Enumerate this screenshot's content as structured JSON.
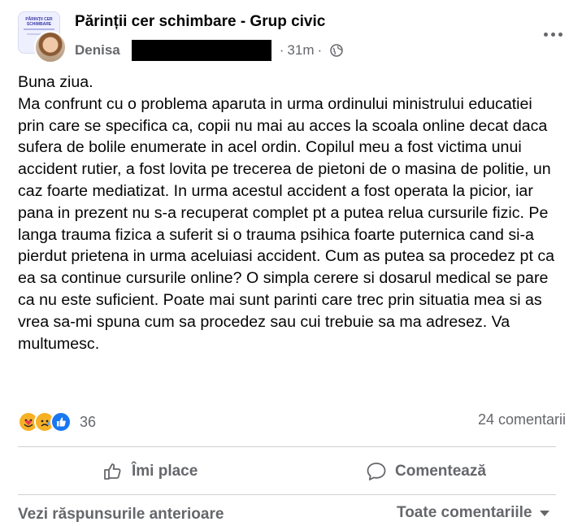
{
  "header": {
    "group_name": "Părinții cer schimbare - Grup civic",
    "group_avatar_text": "PĂRINȚII CER SCHIMBARE",
    "author": "Denisa",
    "separator": "·",
    "time": "31m",
    "privacy_icon": "globe-icon",
    "more_icon": "more-options-icon"
  },
  "post": {
    "text": "Buna ziua.\nMa confrunt cu o problema aparuta in urma ordinului ministrului educatiei prin care se specifica ca, copii nu mai au acces la scoala online decat daca sufera de bolile enumerate in acel ordin. Copilul meu a fost victima unui accident rutier, a fost lovita pe trecerea de pietoni de o masina de politie, un caz foarte mediatizat. In urma acestul accident a fost operata la picior, iar pana in prezent nu s-a recuperat complet pt a putea relua cursurile fizic. Pe langa trauma fizica a suferit si o trauma psihica foarte puternica cand si-a pierdut prietena in urma aceluiasi accident. Cum as putea sa procedez pt ca ea sa continue cursurile online? O simpla cerere si dosarul medical se pare ca nu este suficient. Poate mai sunt parinti care trec prin situatia mea si as vrea sa-mi spuna cum sa procedez sau cui trebuie sa ma adresez. Va multumesc."
  },
  "stats": {
    "reactions": [
      "care",
      "sad",
      "like"
    ],
    "reaction_count": "36",
    "comments": "24 comentarii"
  },
  "actions": {
    "like_label": "Îmi place",
    "comment_label": "Comentează"
  },
  "footer": {
    "previous_replies": "Vezi răspunsurile anterioare",
    "sort_label": "Toate comentariile"
  },
  "colors": {
    "secondary_text": "#65676b",
    "like_blue": "#1877f2",
    "reaction_yellow": "#f7b125",
    "divider": "#ced0d4"
  }
}
